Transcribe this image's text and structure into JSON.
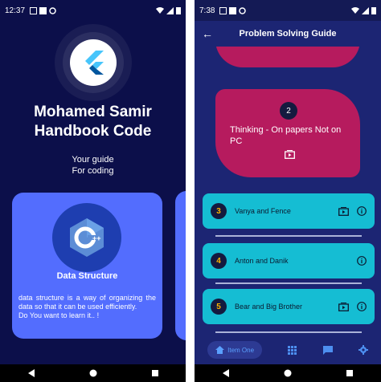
{
  "left_screen": {
    "status": {
      "time": "12:37"
    },
    "title": "Mohamed Samir\nHandbook Code",
    "subtitle": "Your guide\nFor coding",
    "card": {
      "title": "Data Structure",
      "description": "data structure is a way of organizing the data so that it can be used efficiently.\nDo You want to learn it.. !"
    }
  },
  "right_screen": {
    "status": {
      "time": "7:38"
    },
    "appbar_title": "Problem Solving Guide",
    "featured": {
      "number": "2",
      "title": "Thinking - On papers Not on PC"
    },
    "items": [
      {
        "number": "3",
        "label": "Vanya and Fence",
        "has_video": true
      },
      {
        "number": "4",
        "label": "Anton and Danik",
        "has_video": false
      },
      {
        "number": "5",
        "label": "Bear and Big Brother",
        "has_video": true
      }
    ],
    "bottom_nav": {
      "active_label": "Item One"
    }
  },
  "colors": {
    "left_bg": "#0c0f4a",
    "right_bg": "#1c2573",
    "card": "#536dfe",
    "featured": "#b61b5e",
    "item": "#15bdd3",
    "number_badge": "#ffb300"
  }
}
